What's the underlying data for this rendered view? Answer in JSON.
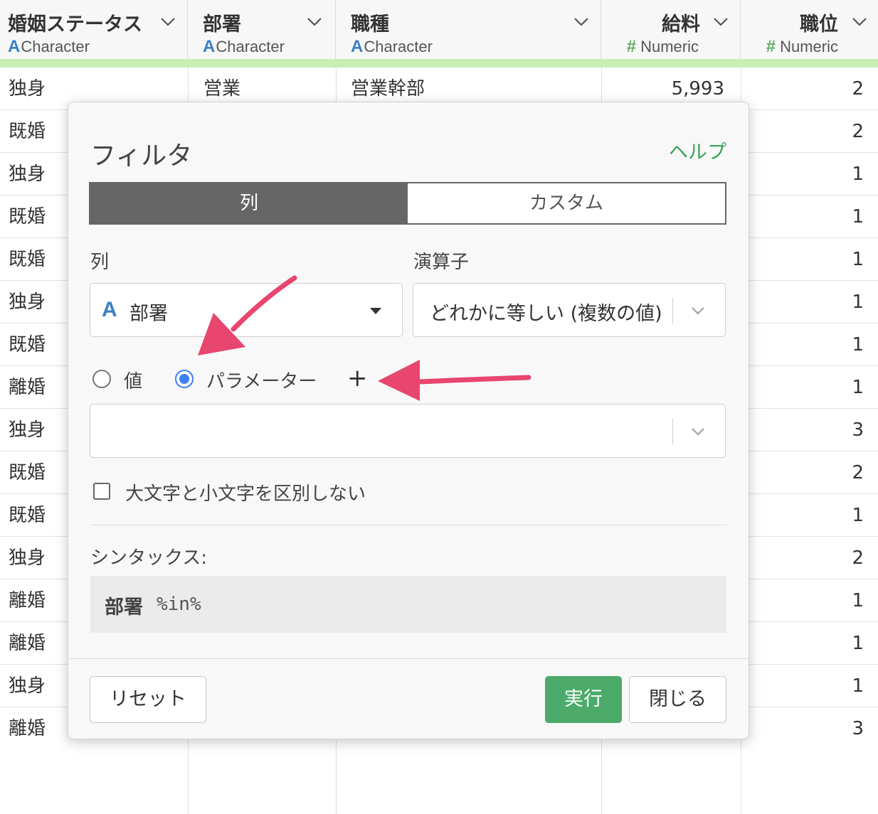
{
  "columns": [
    {
      "name": "婚姻ステータス",
      "type_label": "Character",
      "type_icon": "A"
    },
    {
      "name": "部署",
      "type_label": "Character",
      "type_icon": "A"
    },
    {
      "name": "職種",
      "type_label": "Character",
      "type_icon": "A"
    },
    {
      "name": "給料",
      "type_label": "Numeric",
      "type_icon": "#"
    },
    {
      "name": "職位",
      "type_label": "Numeric",
      "type_icon": "#"
    }
  ],
  "first_row": {
    "marital": "独身",
    "dept": "営業",
    "job": "営業幹部",
    "salary": "5,993",
    "level": "2"
  },
  "rows": [
    {
      "marital": "既婚",
      "level": "2"
    },
    {
      "marital": "独身",
      "level": "1"
    },
    {
      "marital": "既婚",
      "level": "1"
    },
    {
      "marital": "既婚",
      "level": "1"
    },
    {
      "marital": "独身",
      "level": "1"
    },
    {
      "marital": "既婚",
      "level": "1"
    },
    {
      "marital": "離婚",
      "level": "1"
    },
    {
      "marital": "独身",
      "level": "3"
    },
    {
      "marital": "既婚",
      "level": "2"
    },
    {
      "marital": "既婚",
      "level": "1"
    },
    {
      "marital": "独身",
      "level": "2"
    },
    {
      "marital": "離婚",
      "level": "1"
    },
    {
      "marital": "離婚",
      "level": "1"
    },
    {
      "marital": "独身",
      "level": "1"
    },
    {
      "marital": "離婚",
      "level": "3"
    }
  ],
  "dialog": {
    "title": "フィルタ",
    "help_label": "ヘルプ",
    "tabs": [
      "列",
      "カスタム"
    ],
    "active_tab": "列",
    "column_label": "列",
    "column_value": "部署",
    "column_type_icon": "A",
    "operator_label": "演算子",
    "operator_value": "どれかに等しい (複数の値)",
    "radio_value_label": "値",
    "radio_param_label": "パラメーター",
    "selected_radio": "パラメーター",
    "add_symbol": "+",
    "param_select_value": "",
    "case_insensitive_label": "大文字と小文字を区別しない",
    "case_insensitive_checked": false,
    "syntax_label": "シンタックス:",
    "syntax_column": "部署",
    "syntax_operator": "%in%",
    "reset_label": "リセット",
    "run_label": "実行",
    "close_label": "閉じる"
  },
  "colors": {
    "accent_green": "#4cab6a",
    "help_green": "#3aa05a",
    "header_green_bar": "#c7efb4",
    "radio_blue": "#3b82f6",
    "annotation_arrow": "#e8456f",
    "type_character": "#3a7fc8",
    "type_numeric": "#5fae63"
  }
}
